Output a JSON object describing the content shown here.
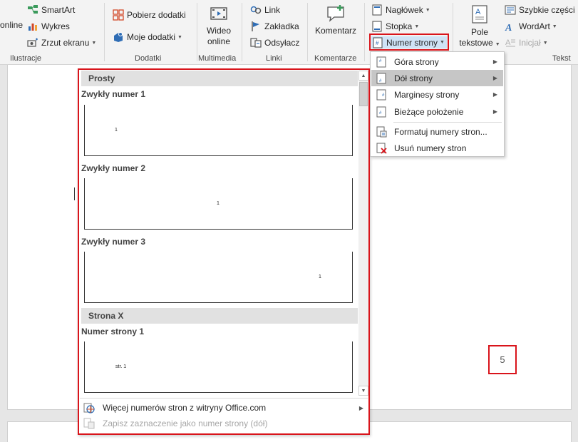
{
  "ribbon": {
    "groups": {
      "ilustracje": {
        "label": "Ilustracje",
        "online_partial": "online",
        "smartart": "SmartArt",
        "wykres": "Wykres",
        "zrzut": "Zrzut ekranu"
      },
      "dodatki": {
        "label": "Dodatki",
        "pobierz": "Pobierz dodatki",
        "moje": "Moje dodatki"
      },
      "multimedia": {
        "label": "Multimedia",
        "wideo_line1": "Wideo",
        "wideo_line2": "online"
      },
      "linki": {
        "label": "Linki",
        "link": "Link",
        "zakladka": "Zakładka",
        "odsylacz": "Odsyłacz"
      },
      "komentarze": {
        "label": "Komentarze",
        "komentarz": "Komentarz"
      },
      "naglowek": {
        "naglowek": "Nagłówek",
        "stopka": "Stopka",
        "numer_strony": "Numer strony"
      },
      "tekst": {
        "label": "Tekst",
        "pole_line1": "Pole",
        "pole_line2": "tekstowe",
        "szybkie": "Szybkie części",
        "wordart": "WordArt",
        "inicjal": "Inicjał"
      }
    }
  },
  "gallery": {
    "category_prosty": "Prosty",
    "item1_title": "Zwykły numer 1",
    "item1_num": "1",
    "item2_title": "Zwykły numer 2",
    "item2_num": "1",
    "item3_title": "Zwykły numer 3",
    "item3_num": "1",
    "category_stronax": "Strona X",
    "item4_title": "Numer strony 1",
    "item4_num": "str. 1",
    "more": "Więcej numerów stron z witryny Office.com",
    "save": "Zapisz zaznaczenie jako numer strony (dół)"
  },
  "submenu": {
    "items": [
      {
        "label": "Góra strony"
      },
      {
        "label": "Dół strony"
      },
      {
        "label": "Marginesy strony"
      },
      {
        "label": "Bieżące położenie"
      },
      {
        "label": "Formatuj numery stron..."
      },
      {
        "label": "Usuń numery stron"
      }
    ]
  },
  "document": {
    "page_number": "5"
  },
  "colors": {
    "highlight": "#d9141b",
    "ribbon_bg": "#f3f3f3",
    "active_item": "#c6c6c6"
  }
}
